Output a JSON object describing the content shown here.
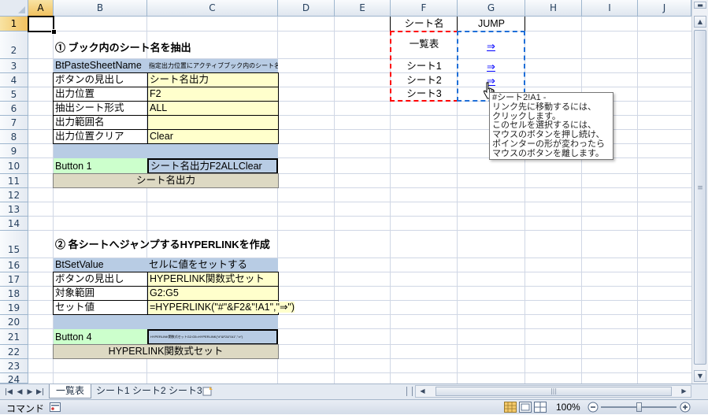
{
  "columns": [
    "A",
    "B",
    "C",
    "D",
    "E",
    "F",
    "G",
    "H",
    "I",
    "J"
  ],
  "rows": [
    "1",
    "2",
    "3",
    "4",
    "5",
    "6",
    "7",
    "8",
    "9",
    "10",
    "11",
    "12",
    "13",
    "14",
    "15",
    "16",
    "17",
    "18",
    "19",
    "20",
    "21",
    "22",
    "23",
    "24"
  ],
  "section1": {
    "heading": "① ブック内のシート名を抽出",
    "macro_name": "BtPasteSheetName",
    "macro_desc": "指定出力位置にアクティブブック内のシート名を抽出",
    "labels": [
      "ボタンの見出し",
      "出力位置",
      "抽出シート形式",
      "出力範囲名",
      "出力位置クリア"
    ],
    "values": [
      "シート名出力",
      "F2",
      "ALL",
      "",
      "Clear"
    ],
    "button_label": "Button 1",
    "button_value": "シート名出力F2ALLClear",
    "button_caption": "シート名出力"
  },
  "section2": {
    "heading": "② 各シートへジャンプするHYPERLINKを作成",
    "macro_name": "BtSetValue",
    "macro_desc": "セルに値をセットする",
    "labels": [
      "ボタンの見出し",
      "対象範囲",
      "セット値"
    ],
    "values": [
      "HYPERLINK関数式セット",
      "G2:G5",
      "=HYPERLINK(\"#\"&F2&\"!A1\",\"⇒\")"
    ],
    "button_label": "Button 4",
    "button_value": "HYPERLINK関数式セットG2:G5=HYPERLINK(\"#\"&F2&\"!A1\",\"⇒\")",
    "button_caption": "HYPERLINK関数式セット"
  },
  "jump_table": {
    "header_name": "シート名",
    "header_jump": "JUMP",
    "sheets": [
      "一覧表",
      "シート1",
      "シート2",
      "シート3"
    ],
    "link_symbol": "⇒"
  },
  "tooltip": {
    "lines": [
      "#シート2!A1 -",
      "リンク先に移動するには、",
      "クリックします。",
      "このセルを選択するには、",
      "マウスのボタンを押し続け、",
      "ポインターの形が変わったら",
      "マウスのボタンを離します。"
    ]
  },
  "sheet_tabs": [
    "一覧表",
    "シート1",
    "シート2",
    "シート3"
  ],
  "status": {
    "mode": "コマンド",
    "zoom": "100%"
  },
  "colors": {
    "red_dash": "#ff0000",
    "blue_dash": "#1f6fd8",
    "header_blue": "#b8cce4",
    "input_yellow": "#ffffcc",
    "button_green": "#ccffcc",
    "button_grey": "#ddd9c3"
  }
}
